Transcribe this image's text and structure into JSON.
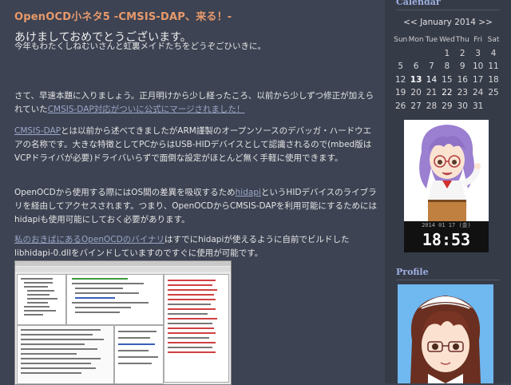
{
  "post": {
    "title": "OpenOCD小ネタ5 -CMSIS-DAP、来る！-",
    "heading": "あけましておめでとうございます。",
    "greeting": "今年もわたくしねむいさんと虹裏メイドたちをどうぞごひいきに。",
    "p1_text": "さて、早速本題に入りましょう。正月明けから少し経ったころ、以前から少しずつ修正が加えられていた",
    "p1_link": "CMSIS-DAP対応がついに公式にマージされました！",
    "p2_link": "CMSIS-DAP",
    "p2_text": "とは以前から述べてきましたがARM謹製のオープンソースのデバッガ・ハードウエアの名称です。大きな特徴としてPCからはUSB-HIDデバイスとして認識されるので(mbed版はVCPドライバが必要)ドライバいらずで面倒な設定がほとんど無く手軽に使用できます。",
    "p3_text_a": "OpenOCDから使用する際にはOS間の差異を吸収するため",
    "p3_link": "hidapi",
    "p3_text_b": "というHIDデバイスのライブラリを経由してアクセスされます。つまり、OpenOCDからCMSIS-DAPを利用可能にするためにはhidapiも使用可能にしておく必要があります。",
    "p4_link": "私のおきばにあるOpenOCDのバイナリ",
    "p4_text": "はすでにhidapiが使えるように自前でビルドしたlibhidapi-0.dllをバインドしていますのですぐに使用が可能です。"
  },
  "sidebar": {
    "calendar_heading": "Calendar",
    "prev": "<<",
    "month": "January 2014",
    "next": ">>",
    "weekdays": [
      "Sun",
      "Mon",
      "Tue",
      "Wed",
      "Thu",
      "Fri",
      "Sat"
    ],
    "weeks": [
      [
        "",
        "",
        "",
        "1",
        "2",
        "3",
        "4"
      ],
      [
        "5",
        "6",
        "7",
        "8",
        "9",
        "10",
        "11"
      ],
      [
        "12",
        "13",
        "14",
        "15",
        "16",
        "17",
        "18"
      ],
      [
        "19",
        "20",
        "21",
        "22",
        "23",
        "24",
        "25"
      ],
      [
        "26",
        "27",
        "28",
        "29",
        "30",
        "31",
        ""
      ]
    ],
    "linked_days": [
      "13",
      "14",
      "22"
    ],
    "today": "13",
    "clock_date": "2014 01 17 (金)",
    "clock_time": "18:53",
    "profile_heading": "Profile"
  },
  "colors": {
    "title": "#e8996a",
    "link": "#9aa6c6",
    "background": "#3d4353",
    "sidebar_heading": "#9fb0e0"
  }
}
